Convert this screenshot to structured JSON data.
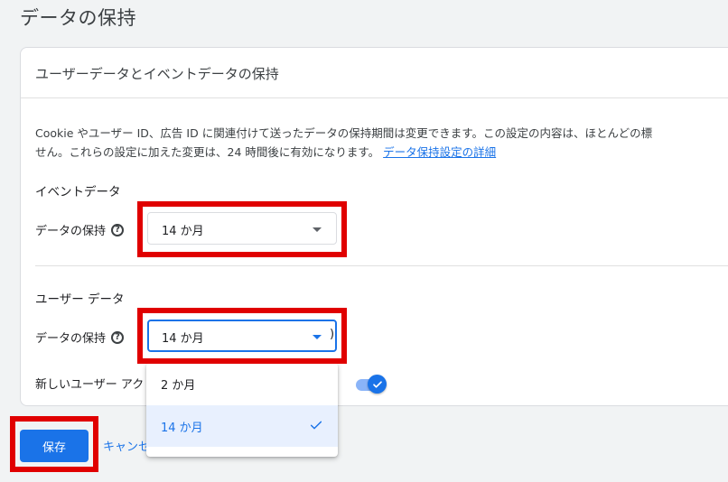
{
  "page": {
    "title": "データの保持"
  },
  "card": {
    "title": "ユーザーデータとイベントデータの保持",
    "description_line1": "Cookie やユーザー ID、広告 ID に関連付けて送ったデータの保持期間は変更できます。この設定の内容は、ほとんどの標",
    "description_line2": "せん。これらの設定に加えた変更は、24 時間後に有効になります。",
    "description_link": "データ保持設定の詳細"
  },
  "event_data": {
    "section_title": "イベントデータ",
    "field_label": "データの保持",
    "value": "14 か月"
  },
  "user_data": {
    "section_title": "ユーザー データ",
    "field_label": "データの保持",
    "value": "14 か月",
    "new_user_label": "新しいユーザー アク",
    "toggle_partial": ")",
    "toggle_on": true
  },
  "dropdown": {
    "options": [
      {
        "label": "2 か月",
        "selected": false
      },
      {
        "label": "14 か月",
        "selected": true
      }
    ]
  },
  "actions": {
    "save_label": "保存",
    "cancel_label": "キャンセル"
  },
  "colors": {
    "accent": "#1a73e8",
    "highlight_box": "#e00000",
    "selected_bg": "#e8f0fe"
  }
}
